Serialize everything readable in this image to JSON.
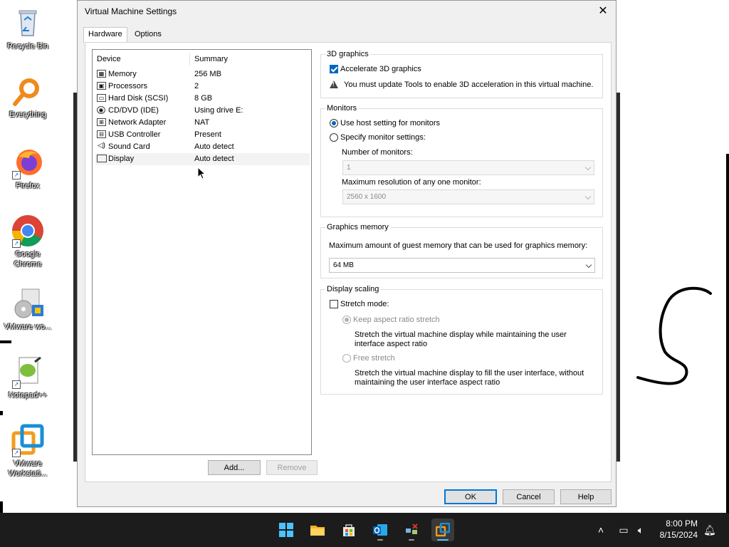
{
  "desktop": {
    "icons": [
      {
        "label": "Recycle Bin"
      },
      {
        "label": "Everything"
      },
      {
        "label": "Firefox"
      },
      {
        "label": "Google Chrome"
      },
      {
        "label": "VMware wo..."
      },
      {
        "label": "Notepad++"
      },
      {
        "label": "VMware Workstati..."
      }
    ]
  },
  "dialog": {
    "title": "Virtual Machine Settings",
    "tabs": [
      {
        "label": "Hardware",
        "active": true
      },
      {
        "label": "Options",
        "active": false
      }
    ],
    "device_list": {
      "columns": [
        "Device",
        "Summary"
      ],
      "rows": [
        {
          "device": "Memory",
          "summary": "256 MB",
          "icon": "memory-icon"
        },
        {
          "device": "Processors",
          "summary": "2",
          "icon": "processor-icon"
        },
        {
          "device": "Hard Disk (SCSI)",
          "summary": "8 GB",
          "icon": "hard-disk-icon"
        },
        {
          "device": "CD/DVD (IDE)",
          "summary": "Using drive E:",
          "icon": "cd-dvd-icon"
        },
        {
          "device": "Network Adapter",
          "summary": "NAT",
          "icon": "network-adapter-icon"
        },
        {
          "device": "USB Controller",
          "summary": "Present",
          "icon": "usb-icon"
        },
        {
          "device": "Sound Card",
          "summary": "Auto detect",
          "icon": "speaker-icon"
        },
        {
          "device": "Display",
          "summary": "Auto detect",
          "icon": "monitor-icon",
          "selected": true
        }
      ]
    },
    "buttons": {
      "add": "Add...",
      "remove": "Remove",
      "ok": "OK",
      "cancel": "Cancel",
      "help": "Help"
    },
    "graphics_3d": {
      "label": "3D graphics",
      "accelerate": "Accelerate 3D graphics",
      "accelerate_checked": true,
      "warning": "You must update Tools to enable 3D acceleration in this virtual machine."
    },
    "monitors": {
      "label": "Monitors",
      "use_host": "Use host setting for monitors",
      "specify": "Specify monitor settings:",
      "number_label": "Number of monitors:",
      "number_value": "1",
      "max_res_label": "Maximum resolution of any one monitor:",
      "max_res_value": "2560 x 1600"
    },
    "graphics_memory": {
      "label": "Graphics memory",
      "description": "Maximum amount of guest memory that can be used for graphics memory:",
      "value": "64 MB"
    },
    "display_scaling": {
      "label": "Display scaling",
      "stretch_mode": "Stretch mode:",
      "keep_aspect": "Keep aspect ratio stretch",
      "keep_aspect_desc_1": "Stretch the virtual machine display while maintaining the user",
      "keep_aspect_desc_2": "interface aspect ratio",
      "free_stretch": "Free stretch",
      "free_stretch_desc_1": "Stretch the virtual machine display to fill the user interface, without",
      "free_stretch_desc_2": "maintaining the user interface aspect ratio"
    }
  },
  "taskbar": {
    "apps": [
      "start-icon",
      "file-explorer-icon",
      "microsoft-store-icon",
      "outlook-icon",
      "network-tool-icon",
      "vmware-workstation-icon"
    ],
    "time": "8:00 PM",
    "date": "8/15/2024"
  },
  "colors": {
    "accent": "#0067c0",
    "taskbar": "#1c1c1c",
    "dialog_bg": "#f0f0f0"
  }
}
